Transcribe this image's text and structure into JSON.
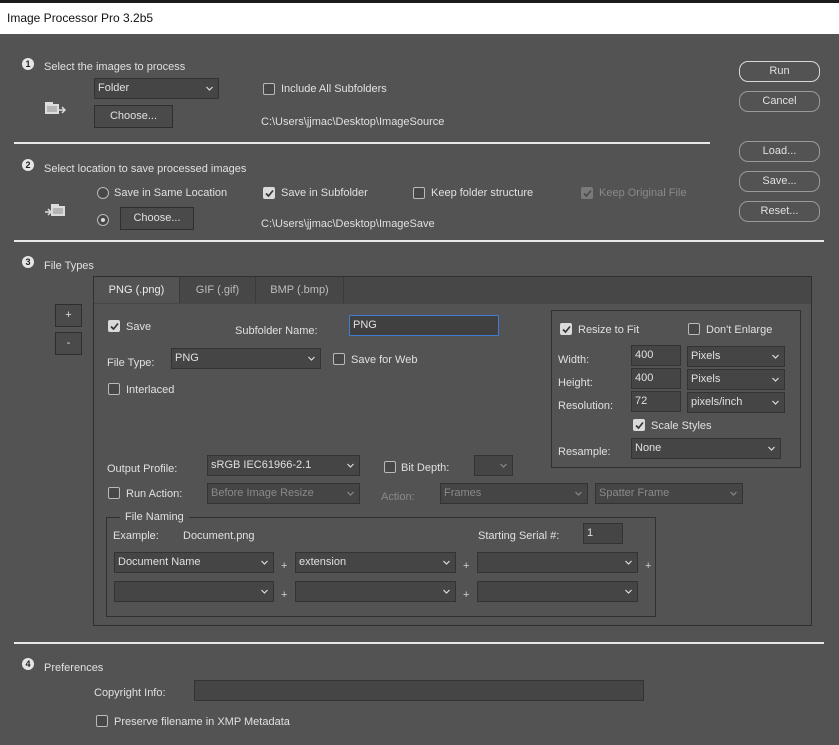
{
  "window": {
    "title": "Image Processor Pro 3.2b5"
  },
  "side_buttons": {
    "run": "Run",
    "cancel": "Cancel",
    "load": "Load...",
    "save": "Save...",
    "reset": "Reset..."
  },
  "section1": {
    "number": "1",
    "title": "Select the images to process",
    "source_select": "Folder",
    "choose_label": "Choose...",
    "include_subfolders_label": "Include All Subfolders",
    "include_subfolders_checked": false,
    "path": "C:\\Users\\jjmac\\Desktop\\ImageSource"
  },
  "section2": {
    "number": "2",
    "title": "Select location to save processed images",
    "same_location_label": "Save in Same Location",
    "save_in_subfolder_label": "Save in Subfolder",
    "save_in_subfolder_checked": true,
    "keep_structure_label": "Keep folder structure",
    "keep_structure_checked": false,
    "keep_original_label": "Keep Original File",
    "choose_label": "Choose...",
    "path": "C:\\Users\\jjmac\\Desktop\\ImageSave"
  },
  "section3": {
    "number": "3",
    "title": "File Types",
    "add_label": "+",
    "remove_label": "-",
    "tabs": [
      {
        "label": "PNG (.png)",
        "active": true
      },
      {
        "label": "GIF (.gif)",
        "active": false
      },
      {
        "label": "BMP (.bmp)",
        "active": false
      }
    ],
    "save_label": "Save",
    "save_checked": true,
    "subfolder_name_label": "Subfolder Name:",
    "subfolder_name_value": "PNG",
    "file_type_label": "File Type:",
    "file_type_value": "PNG",
    "save_for_web_label": "Save for Web",
    "interlaced_label": "Interlaced",
    "resize": {
      "resize_to_fit_label": "Resize to Fit",
      "resize_to_fit_checked": true,
      "dont_enlarge_label": "Don't Enlarge",
      "width_label": "Width:",
      "width_value": "400",
      "width_unit": "Pixels",
      "height_label": "Height:",
      "height_value": "400",
      "height_unit": "Pixels",
      "resolution_label": "Resolution:",
      "resolution_value": "72",
      "resolution_unit": "pixels/inch",
      "scale_styles_label": "Scale Styles",
      "scale_styles_checked": true,
      "resample_label": "Resample:",
      "resample_value": "None"
    },
    "output_profile_label": "Output Profile:",
    "output_profile_value": "sRGB IEC61966-2.1",
    "bit_depth_label": "Bit Depth:",
    "run_action_label": "Run Action:",
    "run_action_value": "Before Image Resize",
    "action_label": "Action:",
    "action_set_value": "Frames",
    "action_value": "Spatter Frame",
    "file_naming": {
      "legend": "File Naming",
      "example_label": "Example:",
      "example_value": "Document.png",
      "serial_label": "Starting Serial #:",
      "serial_value": "1",
      "row1": [
        "Document Name",
        "extension",
        ""
      ],
      "row2": [
        "",
        "",
        ""
      ],
      "plus": "+"
    }
  },
  "section4": {
    "number": "4",
    "title": "Preferences",
    "copyright_label": "Copyright Info:",
    "copyright_value": "",
    "preserve_label": "Preserve filename in XMP Metadata"
  },
  "colors": {
    "background": "#535353",
    "focus_border": "#3d7ed3",
    "title_bar": "#ffffff"
  }
}
